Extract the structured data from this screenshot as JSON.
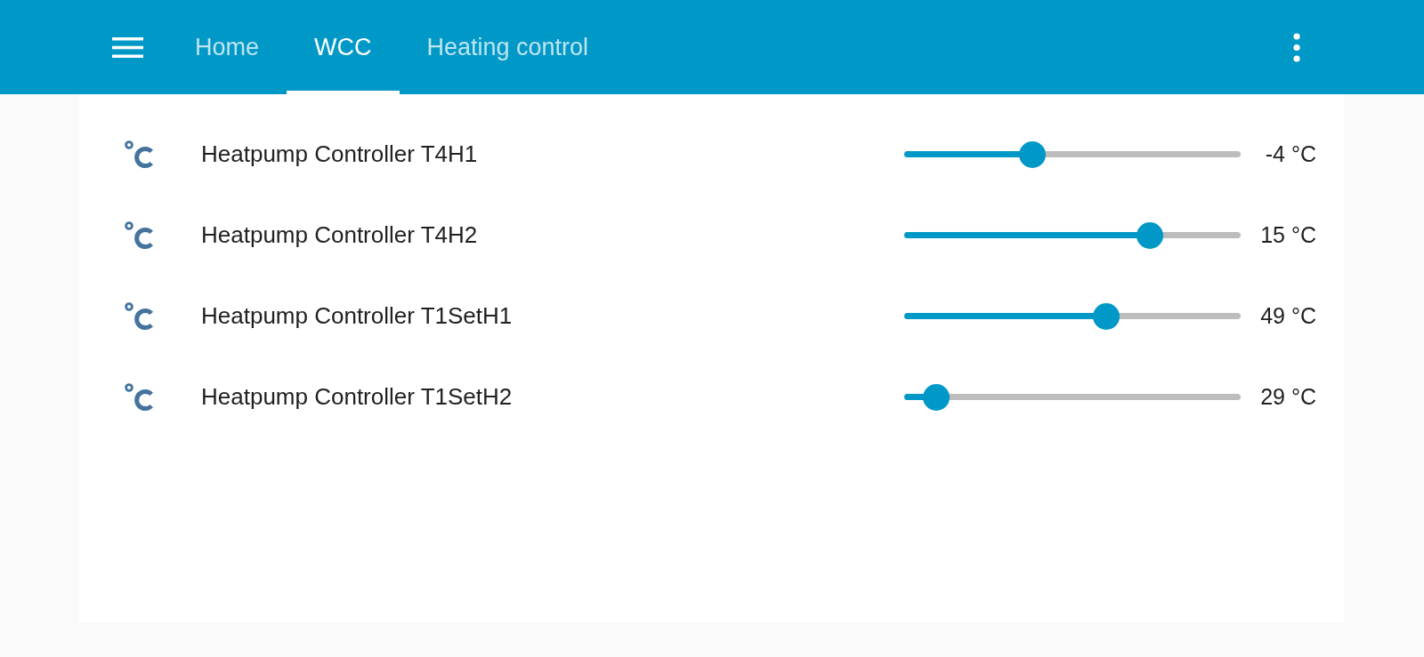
{
  "tabs": [
    {
      "label": "Home",
      "selected": false
    },
    {
      "label": "WCC",
      "selected": true
    },
    {
      "label": "Heating control",
      "selected": false
    }
  ],
  "rows": [
    {
      "name": "Heatpump Controller T4H1",
      "level": 0.37,
      "reading": "-4 °C"
    },
    {
      "name": "Heatpump Controller T4H2",
      "level": 0.75,
      "reading": "15 °C"
    },
    {
      "name": "Heatpump Controller T1SetH1",
      "level": 0.61,
      "reading": "49 °C"
    },
    {
      "name": "Heatpump Controller T1SetH2",
      "level": 0.06,
      "reading": "29 °C"
    }
  ]
}
